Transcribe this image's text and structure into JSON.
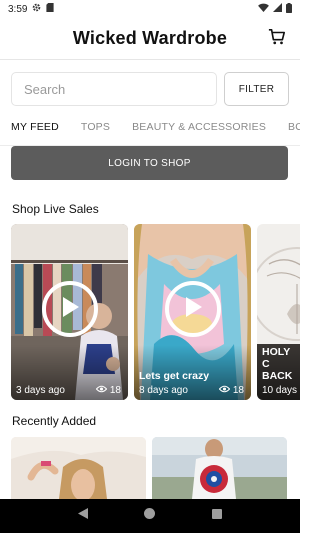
{
  "status_bar": {
    "time": "3:59",
    "icons": [
      "gear-icon",
      "sd-card-icon",
      "wifi-icon",
      "signal-icon",
      "battery-icon"
    ]
  },
  "header": {
    "title": "Wicked Wardrobe",
    "cart_icon": "cart-icon"
  },
  "search": {
    "placeholder": "Search",
    "value": "",
    "filter_label": "FILTER"
  },
  "tabs": [
    {
      "label": "MY FEED",
      "active": true
    },
    {
      "label": "TOPS",
      "active": false
    },
    {
      "label": "BEAUTY & ACCESSORIES",
      "active": false
    },
    {
      "label": "BOTTO",
      "active": false
    }
  ],
  "login_label": "LOGIN TO SHOP",
  "live_sales": {
    "title": "Shop Live Sales",
    "cards": [
      {
        "caption": "",
        "age": "3 days ago",
        "views": "18"
      },
      {
        "caption": "Lets get crazy",
        "age": "8 days ago",
        "views": "18"
      },
      {
        "caption": "HOLY C BACK",
        "age": "10 days",
        "views": ""
      }
    ]
  },
  "recently_added": {
    "title": "Recently Added"
  },
  "colors": {
    "login_button": "#5c5c5c",
    "nav_bar": "#000000",
    "active_tab_indicator": "#222222"
  }
}
